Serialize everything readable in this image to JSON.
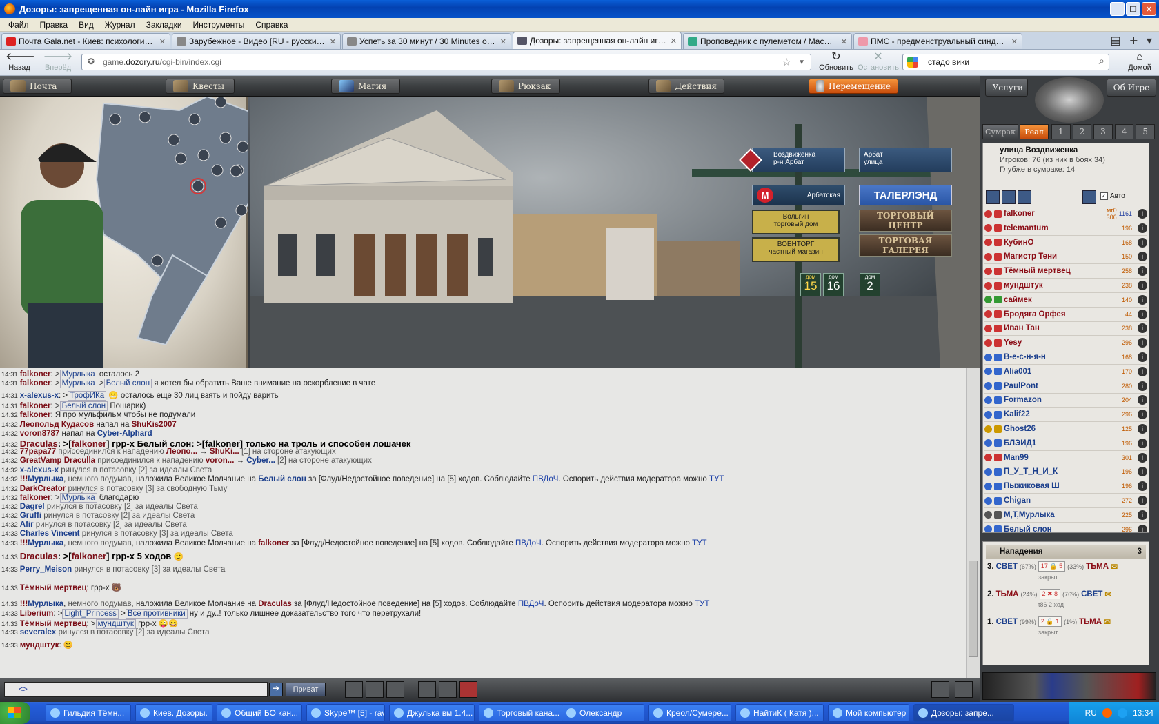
{
  "window": {
    "title": "Дозоры: запрещенная он-лайн игра - Mozilla Firefox"
  },
  "menu": [
    "Файл",
    "Правка",
    "Вид",
    "Журнал",
    "Закладки",
    "Инструменты",
    "Справка"
  ],
  "tabs": [
    {
      "label": "Почта Gala.net - Киев: психологическ...",
      "active": false
    },
    {
      "label": "Зарубежное - Видео [RU - русский] @ ...",
      "active": false
    },
    {
      "label": "Успеть за 30 минут / 30 Minutes or Less...",
      "active": false
    },
    {
      "label": "Дозоры: запрещенная он-лайн игра",
      "active": true
    },
    {
      "label": "Проповедник с пулеметом / Machine Gu...",
      "active": false
    },
    {
      "label": "ПМС - предменструальный синдром - б...",
      "active": false
    }
  ],
  "nav": {
    "back": "Назад",
    "forward": "Вперёд",
    "reload": "Обновить",
    "stop": "Остановить",
    "home": "Домой"
  },
  "url": {
    "prefix": "game.",
    "domain": "dozory.ru",
    "path": "/cgi-bin/index.cgi"
  },
  "search": {
    "value": "стадо вики"
  },
  "game_nav": [
    "Почта",
    "Квесты",
    "Магия",
    "Рюкзак",
    "Действия",
    "Перемещение"
  ],
  "right_top": {
    "services": "Услуги",
    "about": "Об Игре",
    "twilight": "Сумрак",
    "real": "Реал",
    "levels": [
      "1",
      "2",
      "3",
      "4",
      "5"
    ]
  },
  "location": {
    "name": "улица Воздвиженка",
    "players": "Игроков: 76 (из них в боях 34)",
    "depth": "Глубже в сумраке: 14",
    "auto": "Авто"
  },
  "signs": {
    "vozd": [
      "Воздвиженка",
      "р-н Арбат"
    ],
    "arbat": [
      "Арбат",
      "улица"
    ],
    "metro": "Арбатская",
    "talerlend": "ТАЛЕРЛЭНД",
    "tc": "ТОРГОВЫЙ ЦЕНТР",
    "tg": "ТОРГОВАЯ ГАЛЕРЕЯ",
    "volgin": [
      "Вольгин",
      "торговый дом"
    ],
    "voentorg": [
      "ВОЕНТОРГ",
      "частный магазин"
    ],
    "doms": [
      {
        "l": "дом",
        "n": "15"
      },
      {
        "l": "дом",
        "n": "16"
      },
      {
        "l": "дом",
        "n": "2"
      }
    ]
  },
  "users": [
    {
      "name": "falkoner",
      "lv": "мг0 306",
      "extra": "1161",
      "color": "#8b0d16",
      "ic": "#c33"
    },
    {
      "name": "telemantum",
      "lv": "196",
      "color": "#8b0d16",
      "ic": "#c33"
    },
    {
      "name": "КубинО",
      "lv": "168",
      "color": "#8b0d16",
      "ic": "#c33"
    },
    {
      "name": "Магистр Тени",
      "lv": "150",
      "color": "#8b0d16",
      "ic": "#c33"
    },
    {
      "name": "Тёмный мертвец",
      "lv": "258",
      "color": "#8b0d16",
      "ic": "#c33"
    },
    {
      "name": "мундштук",
      "lv": "238",
      "color": "#8b0d16",
      "ic": "#c33"
    },
    {
      "name": "саймек",
      "lv": "140",
      "color": "#8b0d16",
      "ic": "#393"
    },
    {
      "name": "Бродяга Орфея",
      "lv": "44",
      "color": "#8b0d16",
      "ic": "#c33"
    },
    {
      "name": "Иван Тан",
      "lv": "238",
      "color": "#8b0d16",
      "ic": "#c33"
    },
    {
      "name": "Yesy",
      "lv": "296",
      "color": "#8b0d16",
      "ic": "#c33"
    },
    {
      "name": "В-е-с-н-я-н",
      "lv": "168",
      "color": "#1c3f8c",
      "ic": "#36c"
    },
    {
      "name": "Alia001",
      "lv": "170",
      "color": "#1c3f8c",
      "ic": "#36c"
    },
    {
      "name": "PaulPont",
      "lv": "280",
      "color": "#1c3f8c",
      "ic": "#36c"
    },
    {
      "name": "Formazon",
      "lv": "204",
      "color": "#1c3f8c",
      "ic": "#36c"
    },
    {
      "name": "Kalif22",
      "lv": "296",
      "color": "#1c3f8c",
      "ic": "#36c"
    },
    {
      "name": "Ghost26",
      "lv": "125",
      "color": "#1c3f8c",
      "ic": "#c90"
    },
    {
      "name": "БЛЭЙД1",
      "lv": "196",
      "color": "#1c3f8c",
      "ic": "#36c"
    },
    {
      "name": "Man99",
      "lv": "301",
      "color": "#1c3f8c",
      "ic": "#c33"
    },
    {
      "name": "П_У_Т_Н_И_К",
      "lv": "196",
      "color": "#1c3f8c",
      "ic": "#36c"
    },
    {
      "name": "Пыжиковая Ш",
      "lv": "196",
      "color": "#1c3f8c",
      "ic": "#36c"
    },
    {
      "name": "Chigan",
      "lv": "272",
      "color": "#1c3f8c",
      "ic": "#36c"
    },
    {
      "name": "М,Т,Мурлыка",
      "lv": "225",
      "color": "#1c3f8c",
      "ic": "#555"
    },
    {
      "name": "Белый слон",
      "lv": "296",
      "color": "#1c3f8c",
      "ic": "#36c"
    }
  ],
  "attacks": {
    "title": "Нападения",
    "count": "3",
    "rows": [
      {
        "n": "3.",
        "a": "СВЕТ",
        "ap": "(67%)",
        "box": "17 🔒 5",
        "bp": "(33%)",
        "b": "ТЬМА",
        "note": "закрыт"
      },
      {
        "n": "2.",
        "a": "ТЬМА",
        "ap": "(24%)",
        "box": "2 ✖ 8",
        "bp": "(76%)",
        "b": "СВЕТ",
        "note": "t86   2 ход"
      },
      {
        "n": "1.",
        "a": "СВЕТ",
        "ap": "(99%)",
        "box": "2 🔒 1",
        "bp": "(1%)",
        "b": "ТЬМА",
        "note": "закрыт"
      }
    ]
  },
  "chat": [
    {
      "t": "14:31",
      "html": "<span class='nick'>falkoner</span>: &gt;<span class='pr'>Мурлыка</span>  осталось 2"
    },
    {
      "t": "14:31",
      "html": "<span class='nick'>falkoner</span>: &gt;<span class='pr'>Мурлыка</span> &gt;<span class='pr'>Белый слон</span>  я хотел бы обратить Ваше внимание на оскорбление в чате"
    },
    {
      "t": "14:31",
      "html": "<span class='nickb'>x-alexus-x</span>: &gt;<span class='pr'>ТрофИКа</span>  😬 осталось еще 30 лиц взять и пойду варить"
    },
    {
      "t": "14:31",
      "html": "<span class='nick'>falkoner</span>: &gt;<span class='pr'>Белый слон</span>  Пошарик)"
    },
    {
      "t": "14:32",
      "html": "<span class='nick'>falkoner</span>:  Я про мульфильм чтобы не подумали"
    },
    {
      "t": "14:32",
      "html": "<span class='nick'>Леопольд Кудасов</span> напал на <span class='nick'>ShuKis2007</span>"
    },
    {
      "t": "14:32",
      "html": "<span class='nick'>voron8787</span> напал на <span class='nickb'>Cyber-Alphard</span>"
    },
    {
      "t": "14:32",
      "html": "<span class='big'><span class='nick'>Draculas</span>: &gt;[<span class='nick'>falkoner</span>]  грр-х Белый слон: &gt;[falkoner] только на троль и способен лошачек</span>"
    },
    {
      "t": "14:32",
      "html": "<span class='nick'>77papa77</span> <span class='gray'>присоединился к нападению</span> <span class='nick'>Леопо...</span> → <span class='nick'>ShuKi...</span> <span class='gray'>[1] на стороне атакующих</span>"
    },
    {
      "t": "14:32",
      "html": "<span class='nick'>GreatVamp Draculla</span> <span class='gray'>присоединился к нападению</span> <span class='nick'>voron...</span> → <span class='nickb'>Cyber...</span> <span class='gray'>[2] на стороне атакующих</span>"
    },
    {
      "t": "14:32",
      "html": "<span class='nickb'>x-alexus-x</span> <span class='gray'>ринулся в потасовку [2] за идеалы Света</span>"
    },
    {
      "t": "14:32",
      "html": "<span class='nick'>!!!</span><span class='nickb'>Мурлыка</span>, <span class='gray'>немного подумав,</span> наложила Великое Молчание на <span class='nickb'>Белый слон</span> за [Флуд/Недостойное поведение] на [5] ходов. Соблюдайте <span class='link'>ПВДоЧ</span>. Оспорить действия модератора можно <span class='link'>ТУТ</span>"
    },
    {
      "t": "14:32",
      "html": "<span class='nick'>DarkCreator</span> <span class='gray'>ринулся в потасовку [3] за свободную Тьму</span>"
    },
    {
      "t": "14:32",
      "html": "<span class='nick'>falkoner</span>: &gt;<span class='pr'>Мурлыка</span>  благодарю"
    },
    {
      "t": "14:32",
      "html": "<span class='nickb'>Dagrel</span> <span class='gray'>ринулся в потасовку [2] за идеалы Света</span>"
    },
    {
      "t": "14:32",
      "html": "<span class='nickb'>Gruffi</span> <span class='gray'>ринулся в потасовку [2] за идеалы Света</span>"
    },
    {
      "t": "14:32",
      "html": "<span class='nickb'>Afir</span> <span class='gray'>ринулся в потасовку [2] за идеалы Света</span>"
    },
    {
      "t": "14:33",
      "html": "<span class='nickb'>Charles Vincent</span> <span class='gray'>ринулся в потасовку [3] за идеалы Света</span>"
    },
    {
      "t": "14:33",
      "html": "<span class='nick'>!!!</span><span class='nickb'>Мурлыка</span>, <span class='gray'>немного подумав,</span> наложила Великое Молчание на <span class='nick'>falkoner</span> за [Флуд/Недостойное поведение] на [5] ходов. Соблюдайте <span class='link'>ПВДоЧ</span>. Оспорить действия модератора можно <span class='link'>ТУТ</span>"
    },
    {
      "t": "14:33",
      "html": "<span class='big'><span class='nick'>Draculas</span>: &gt;[<span class='nick'>falkoner</span>]  грр-х 5 ходов</span> 🙂"
    },
    {
      "t": "14:33",
      "html": "<span class='nickb'>Perry_Meison</span> <span class='gray'>ринулся в потасовку [3] за идеалы Света</span>"
    },
    {
      "t": "14:33",
      "html": "<span class='nick'>Тёмный мертвец</span>:  грр-х  🐻"
    },
    {
      "t": "14:33",
      "html": "<span class='nick'>!!!</span><span class='nickb'>Мурлыка</span>, <span class='gray'>немного подумав,</span> наложила Великое Молчание на <span class='nick'>Draculas</span> за [Флуд/Недостойное поведение] на [5] ходов. Соблюдайте <span class='link'>ПВДоЧ</span>. Оспорить действия модератора можно <span class='link'>ТУТ</span>"
    },
    {
      "t": "14:33",
      "html": "<span class='nick'>Liberium</span>: &gt;<span class='pr'>Light_Princess</span> &gt;<span class='pr'>Все противники</span>  ну и ду..! только лишнее доказательство того что перетрухали!"
    },
    {
      "t": "14:33",
      "html": "<span class='nick'>Тёмный мертвец</span>: &gt;<span class='pr'>мундштук</span>  грр-х 😜😄"
    },
    {
      "t": "14:33",
      "html": "<span class='nickb'>severalex</span> <span class='gray'>ринулся в потасовку [2] за идеалы Света</span>"
    },
    {
      "t": "14:33",
      "html": "<span class='nick'>мундштук</span>:  😊"
    }
  ],
  "chat_input": {
    "prefix": "<>",
    "private": "Приват"
  },
  "taskbar": [
    {
      "label": "Гильдия Тёмн...",
      "act": false
    },
    {
      "label": "Киев. Дозоры.",
      "act": false
    },
    {
      "label": "Общий БО кан...",
      "act": false
    },
    {
      "label": "Skype™ [5] - rav...",
      "act": false
    },
    {
      "label": "Джулька вм 1.4...",
      "act": false
    },
    {
      "label": "Торговый кана...",
      "act": false
    },
    {
      "label": "Олександр",
      "act": false
    },
    {
      "label": "Креол/Сумере...",
      "act": false
    },
    {
      "label": "НайтиК ( Катя )...",
      "act": false
    },
    {
      "label": "Мой компьютер",
      "act": false
    },
    {
      "label": "Дозоры: запре...",
      "act": true
    }
  ],
  "tray": {
    "lang": "RU",
    "time": "13:34"
  }
}
